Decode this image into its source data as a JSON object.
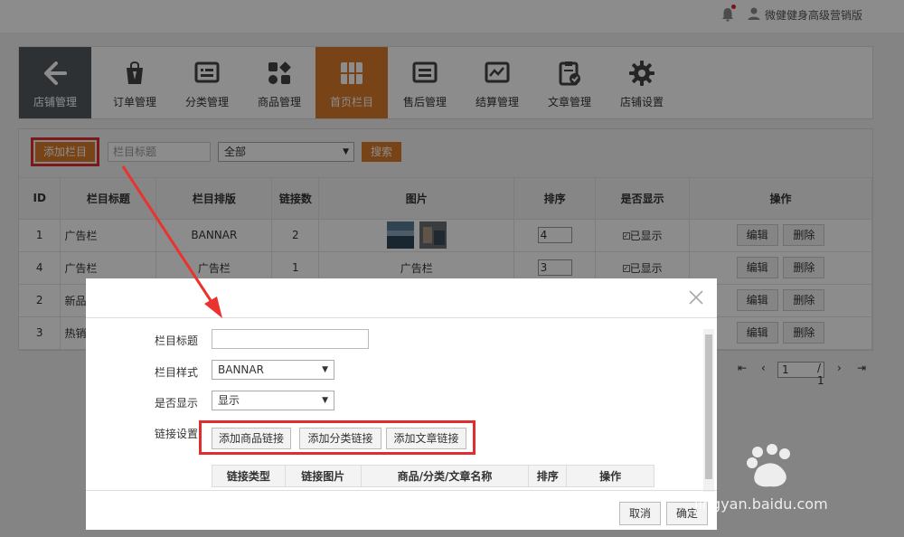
{
  "topbar": {
    "user_name": "微健健身高级营销版"
  },
  "nav": {
    "items": [
      {
        "label": "店铺管理",
        "icon": "back-arrow-icon"
      },
      {
        "label": "订单管理",
        "icon": "shopping-bag-icon"
      },
      {
        "label": "分类管理",
        "icon": "category-icon"
      },
      {
        "label": "商品管理",
        "icon": "grid-shapes-icon"
      },
      {
        "label": "首页栏目",
        "icon": "columns-icon"
      },
      {
        "label": "售后管理",
        "icon": "after-sales-icon"
      },
      {
        "label": "结算管理",
        "icon": "chart-icon"
      },
      {
        "label": "文章管理",
        "icon": "clipboard-check-icon"
      },
      {
        "label": "店铺设置",
        "icon": "gear-icon"
      }
    ],
    "active": "首页栏目"
  },
  "toolbar": {
    "add_label": "添加栏目",
    "title_placeholder": "栏目标题",
    "filter_value": "全部",
    "search_label": "搜索"
  },
  "table": {
    "headers": [
      "ID",
      "栏目标题",
      "栏目排版",
      "链接数",
      "图片",
      "排序",
      "是否显示",
      "操作"
    ],
    "rows": [
      {
        "id": "1",
        "title": "广告栏",
        "layout": "BANNAR",
        "links": "2",
        "image_text": "",
        "sort": "4",
        "show": "已显示"
      },
      {
        "id": "4",
        "title": "广告栏",
        "layout": "广告栏",
        "links": "1",
        "image_text": "广告栏",
        "sort": "3",
        "show": "已显示"
      },
      {
        "id": "2",
        "title": "新品",
        "layout": "",
        "links": "",
        "image_text": "",
        "sort": "",
        "show": ""
      },
      {
        "id": "3",
        "title": "热销",
        "layout": "",
        "links": "",
        "image_text": "",
        "sort": "",
        "show": ""
      }
    ],
    "edit_label": "编辑",
    "delete_label": "删除"
  },
  "pager": {
    "page": "1",
    "total": "/ 1"
  },
  "modal": {
    "title_label": "栏目标题",
    "style_label": "栏目样式",
    "style_value": "BANNAR",
    "show_label": "是否显示",
    "show_value": "显示",
    "link_label": "链接设置",
    "link_buttons": [
      "添加商品链接",
      "添加分类链接",
      "添加文章链接"
    ],
    "link_headers": [
      "链接类型",
      "链接图片",
      "商品/分类/文章名称",
      "排序",
      "操作"
    ],
    "cancel_label": "取消",
    "ok_label": "确定"
  },
  "watermark": {
    "text": "jingyan.baidu.com"
  },
  "colors": {
    "accent": "#d97b2a",
    "highlight": "#e02e2e",
    "nav_back": "#555a60"
  }
}
